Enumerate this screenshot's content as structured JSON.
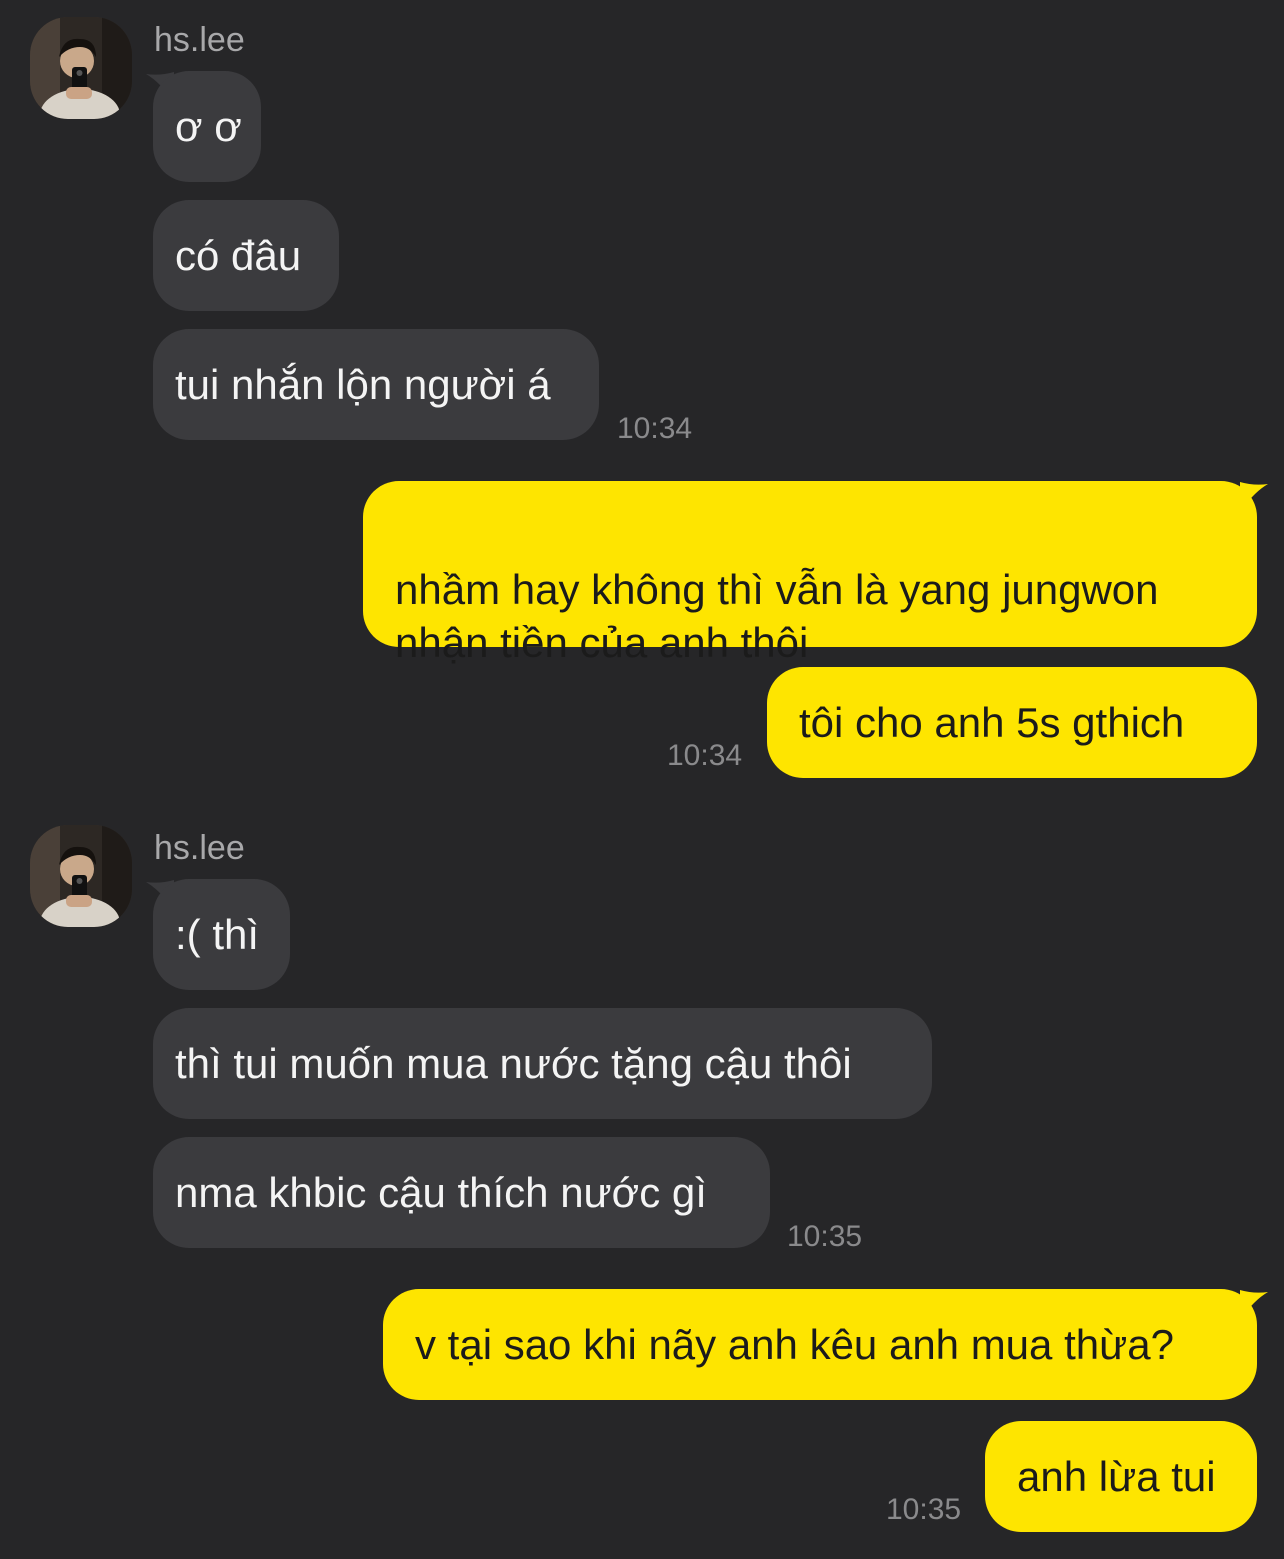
{
  "colors": {
    "background": "#262628",
    "incoming_bubble": "#3b3b3e",
    "outgoing_bubble": "#fee500",
    "timestamp": "#8a8a8c",
    "sender_name": "#a8a8aa"
  },
  "groups": [
    {
      "sender": "hs.lee",
      "avatar": "profile-photo",
      "messages": [
        "ơ ơ",
        "có đâu",
        "tui nhắn lộn người á"
      ],
      "time": "10:34"
    },
    {
      "outgoing": true,
      "messages": [
        "nhầm hay không thì vẫn là yang jungwon\nnhận tiền của anh thôi",
        "tôi cho anh 5s gthich"
      ],
      "time": "10:34"
    },
    {
      "sender": "hs.lee",
      "avatar": "profile-photo",
      "messages": [
        ":( thì",
        "thì tui muốn mua nước tặng cậu thôi",
        "nma khbic cậu thích nước gì"
      ],
      "time": "10:35"
    },
    {
      "outgoing": true,
      "messages": [
        "v tại sao khi nãy anh kêu anh mua thừa?",
        "anh lừa tui"
      ],
      "time": "10:35"
    }
  ]
}
